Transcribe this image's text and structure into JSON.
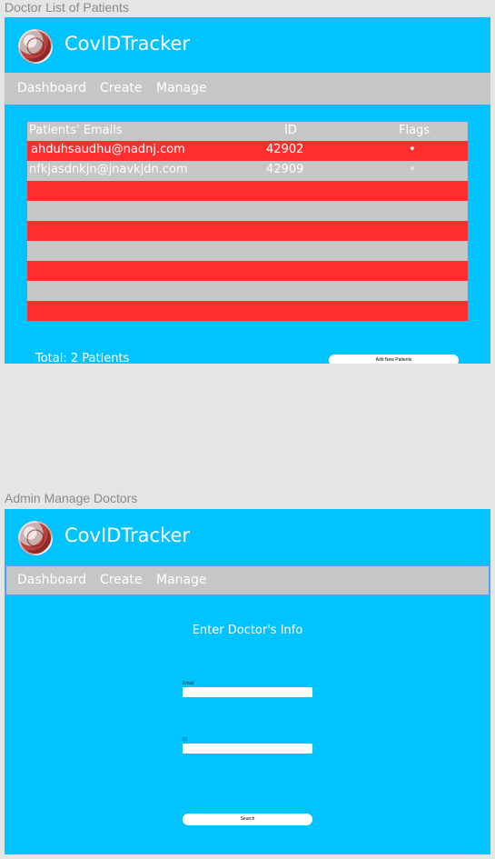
{
  "frame1": {
    "label": "Doctor List of Patients",
    "app_title": "CovIDTracker",
    "nav": {
      "dashboard": "Dashboard",
      "create": "Create",
      "manage": "Manage"
    },
    "table": {
      "headers": {
        "email": "Patients' Emails",
        "id": "ID",
        "flags": "Flags"
      },
      "rows": [
        {
          "email": "ahduhsaudhu@nadnj.com",
          "id": "42902",
          "flag": "•"
        },
        {
          "email": "nfkjasdnkjn@jnavkjdn.com",
          "id": "42909",
          "flag": "•"
        },
        {
          "email": "",
          "id": "",
          "flag": ""
        },
        {
          "email": "",
          "id": "",
          "flag": ""
        },
        {
          "email": "",
          "id": "",
          "flag": ""
        },
        {
          "email": "",
          "id": "",
          "flag": ""
        },
        {
          "email": "",
          "id": "",
          "flag": ""
        },
        {
          "email": "",
          "id": "",
          "flag": ""
        },
        {
          "email": "",
          "id": "",
          "flag": ""
        }
      ]
    },
    "total": "Total: 2 Patients",
    "add_button": "Add New Patients"
  },
  "frame2": {
    "label": "Admin Manage Doctors",
    "app_title": "CovIDTracker",
    "nav": {
      "dashboard": "Dashboard",
      "create": "Create",
      "manage": "Manage"
    },
    "form_title": "Enter Doctor's Info",
    "email_label": "Email",
    "id_label": "ID",
    "search_button": "Search"
  },
  "colors": {
    "primary": "#00c3ff",
    "nav_bg": "#c6c6c6",
    "row_red": "#ff2e2e",
    "row_grey": "#c6c6c6",
    "background": "#e5e5e5"
  }
}
